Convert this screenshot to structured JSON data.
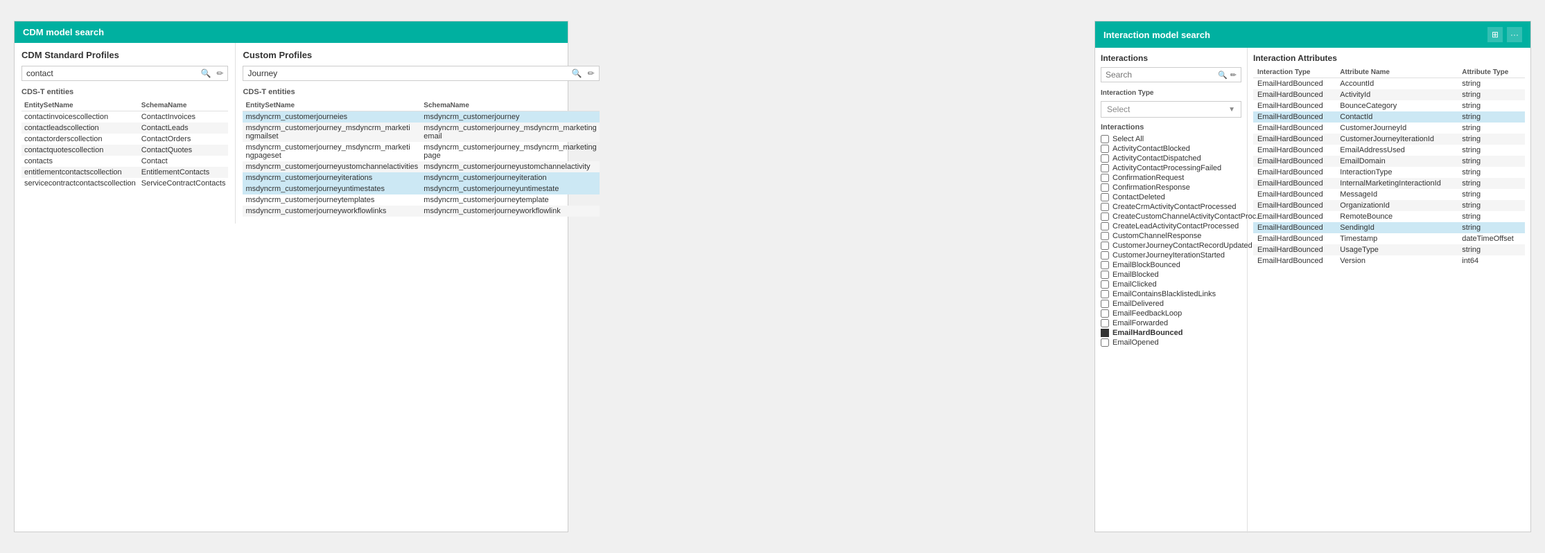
{
  "cdm_panel": {
    "title": "CDM model search",
    "left_section": {
      "title": "CDM Standard Profiles",
      "search_value": "contact",
      "entities_label": "CDS-T entities",
      "columns": [
        "EntitySetName",
        "SchemaName"
      ],
      "rows": [
        {
          "entity": "contactinvoicescollection",
          "schema": "ContactInvoices"
        },
        {
          "entity": "contactleadscollection",
          "schema": "ContactLeads"
        },
        {
          "entity": "contactorderscollection",
          "schema": "ContactOrders"
        },
        {
          "entity": "contactquotescollection",
          "schema": "ContactQuotes"
        },
        {
          "entity": "contacts",
          "schema": "Contact"
        },
        {
          "entity": "entitlementcontactscollection",
          "schema": "EntitlementContacts"
        },
        {
          "entity": "servicecontractcontactscollection",
          "schema": "ServiceContractContacts"
        }
      ]
    },
    "right_section": {
      "title": "Custom Profiles",
      "search_value": "Journey",
      "entities_label": "CDS-T entities",
      "columns": [
        "EntitySetName",
        "SchemaName"
      ],
      "rows": [
        {
          "entity": "msdyncrm_customerjourneies",
          "schema": "msdyncrm_customerjourney",
          "highlight": true
        },
        {
          "entity": "msdyncrm_customerjourney_msdyncrm_marketi ngmailset",
          "schema": "msdyncrm_customerjourney_msdyncrm_marketing email"
        },
        {
          "entity": "msdyncrm_customerjourney_msdyncrm_marketi ngpageset",
          "schema": "msdyncrm_customerjourney_msdyncrm_marketing page"
        },
        {
          "entity": "msdyncrm_customerjourneyustomchannelactivities",
          "schema": "msdyncrm_customerjourneyustomchannelactivity"
        },
        {
          "entity": "msdyncrm_customerjourneyiterations",
          "schema": "msdyncrm_customerjourneyiteration",
          "highlight": true
        },
        {
          "entity": "msdyncrm_customerjourneyuntimestates",
          "schema": "msdyncrm_customerjourneyuntimestate",
          "highlight": true
        },
        {
          "entity": "msdyncrm_customerjourneytemplates",
          "schema": "msdyncrm_customerjourneytemplate"
        },
        {
          "entity": "msdyncrm_customerjourneyworkflowlinks",
          "schema": "msdyncrm_customerjourneyworkflowlink"
        }
      ]
    }
  },
  "interaction_panel": {
    "title": "Interaction model search",
    "left": {
      "title": "Interactions",
      "search_placeholder": "Search",
      "interactions_label": "Interactions",
      "select_all": "Select All",
      "items": [
        {
          "label": "ActivityContactBlocked",
          "checked": false
        },
        {
          "label": "ActivityContactDispatched",
          "checked": false
        },
        {
          "label": "ActivityContactProcessingFailed",
          "checked": false
        },
        {
          "label": "ConfirmationRequest",
          "checked": false
        },
        {
          "label": "ConfirmationResponse",
          "checked": false
        },
        {
          "label": "ContactDeleted",
          "checked": false
        },
        {
          "label": "CreateCrmActivityContactProcessed",
          "checked": false
        },
        {
          "label": "CreateCustomChannelActivityContactProc...",
          "checked": false
        },
        {
          "label": "CreateLeadActivityContactProcessed",
          "checked": false
        },
        {
          "label": "CustomChannelResponse",
          "checked": false
        },
        {
          "label": "CustomerJourneyContactRecordUpdated",
          "checked": false
        },
        {
          "label": "CustomerJourneyIterationStarted",
          "checked": false
        },
        {
          "label": "EmailBlockBounced",
          "checked": false
        },
        {
          "label": "EmailBlocked",
          "checked": false
        },
        {
          "label": "EmailClicked",
          "checked": false
        },
        {
          "label": "EmailContainsBlacklistedLinks",
          "checked": false
        },
        {
          "label": "EmailDelivered",
          "checked": false
        },
        {
          "label": "EmailFeedbackLoop",
          "checked": false
        },
        {
          "label": "EmailForwarded",
          "checked": false
        },
        {
          "label": "EmailHardBounced",
          "checked": true,
          "filled": true
        },
        {
          "label": "EmailOpened",
          "checked": false
        }
      ]
    },
    "right": {
      "title": "Interaction Attributes",
      "columns": [
        "Interaction Type",
        "Attribute Name",
        "Attribute Type"
      ],
      "rows": [
        {
          "type": "EmailHardBounced",
          "name": "AccountId",
          "attr_type": "string"
        },
        {
          "type": "EmailHardBounced",
          "name": "ActivityId",
          "attr_type": "string"
        },
        {
          "type": "EmailHardBounced",
          "name": "BounceCategory",
          "attr_type": "string"
        },
        {
          "type": "EmailHardBounced",
          "name": "ContactId",
          "attr_type": "string",
          "highlight": true
        },
        {
          "type": "EmailHardBounced",
          "name": "CustomerJourneyId",
          "attr_type": "string"
        },
        {
          "type": "EmailHardBounced",
          "name": "CustomerJourneyIterationId",
          "attr_type": "string"
        },
        {
          "type": "EmailHardBounced",
          "name": "EmailAddressUsed",
          "attr_type": "string"
        },
        {
          "type": "EmailHardBounced",
          "name": "EmailDomain",
          "attr_type": "string"
        },
        {
          "type": "EmailHardBounced",
          "name": "InteractionType",
          "attr_type": "string"
        },
        {
          "type": "EmailHardBounced",
          "name": "InternalMarketingInteractionId",
          "attr_type": "string"
        },
        {
          "type": "EmailHardBounced",
          "name": "MessageId",
          "attr_type": "string"
        },
        {
          "type": "EmailHardBounced",
          "name": "OrganizationId",
          "attr_type": "string"
        },
        {
          "type": "EmailHardBounced",
          "name": "RemoteBounce",
          "attr_type": "string"
        },
        {
          "type": "EmailHardBounced",
          "name": "SendingId",
          "attr_type": "string",
          "highlight": true
        },
        {
          "type": "EmailHardBounced",
          "name": "Timestamp",
          "attr_type": "dateTimeOffset"
        },
        {
          "type": "EmailHardBounced",
          "name": "UsageType",
          "attr_type": "string"
        },
        {
          "type": "EmailHardBounced",
          "name": "Version",
          "attr_type": "int64"
        }
      ],
      "select_label": "Select",
      "interaction_type_label": "Interaction Type"
    }
  }
}
